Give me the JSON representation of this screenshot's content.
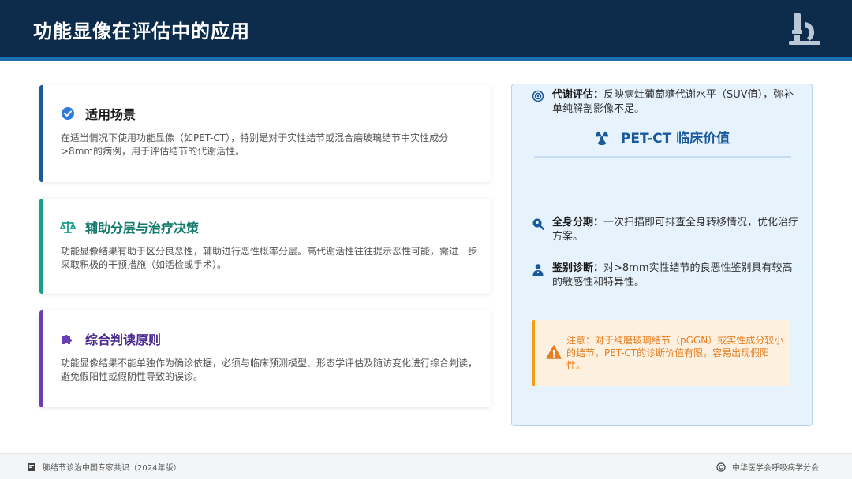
{
  "header": {
    "title": "功能显像在评估中的应用",
    "icon": "microscope-icon"
  },
  "cards": [
    {
      "icon": "check-circle-icon",
      "title": "适用场景",
      "body": "在适当情况下使用功能显像（如PET-CT），特别是对于实性结节或混合磨玻璃结节中实性成分>8mm的病例，用于评估结节的代谢活性。",
      "accent": "#1d5a9c"
    },
    {
      "icon": "balance-scale-icon",
      "title": "辅助分层与治疗决策",
      "body": "功能显像结果有助于区分良恶性，辅助进行恶性概率分层。高代谢活性往往提示恶性可能，需进一步采取积极的干预措施（如活检或手术）。",
      "accent": "#18a08d"
    },
    {
      "icon": "puzzle-piece-icon",
      "title": "综合判读原则",
      "body": "功能显像结果不能单独作为确诊依据，必须与临床预测模型、形态学评估及随访变化进行综合判读，避免假阳性或假阴性导致的误诊。",
      "accent": "#6a3fb5"
    }
  ],
  "panel": {
    "title": "PET-CT 临床价值",
    "items": [
      {
        "icon": "target-icon",
        "label": "代谢评估：",
        "text": "反映病灶葡萄糖代谢水平（SUV值），弥补单纯解剖影像不足。"
      },
      {
        "icon": "search-location-icon",
        "label": "全身分期：",
        "text": "一次扫描即可排查全身转移情况，优化治疗方案。"
      },
      {
        "icon": "user-doctor-icon",
        "label": "鉴别诊断：",
        "text": "对>8mm实性结节的良恶性鉴别具有较高的敏感性和特异性。"
      }
    ]
  },
  "note": {
    "text": "注意：对于纯磨玻璃结节（pGGN）或实性成分较小的结节，PET-CT的诊断价值有限，容易出现假阳性。"
  },
  "footer": {
    "left": "肺结节诊治中国专家共识（2024年版）",
    "right": "中华医学会呼吸病学分会"
  }
}
